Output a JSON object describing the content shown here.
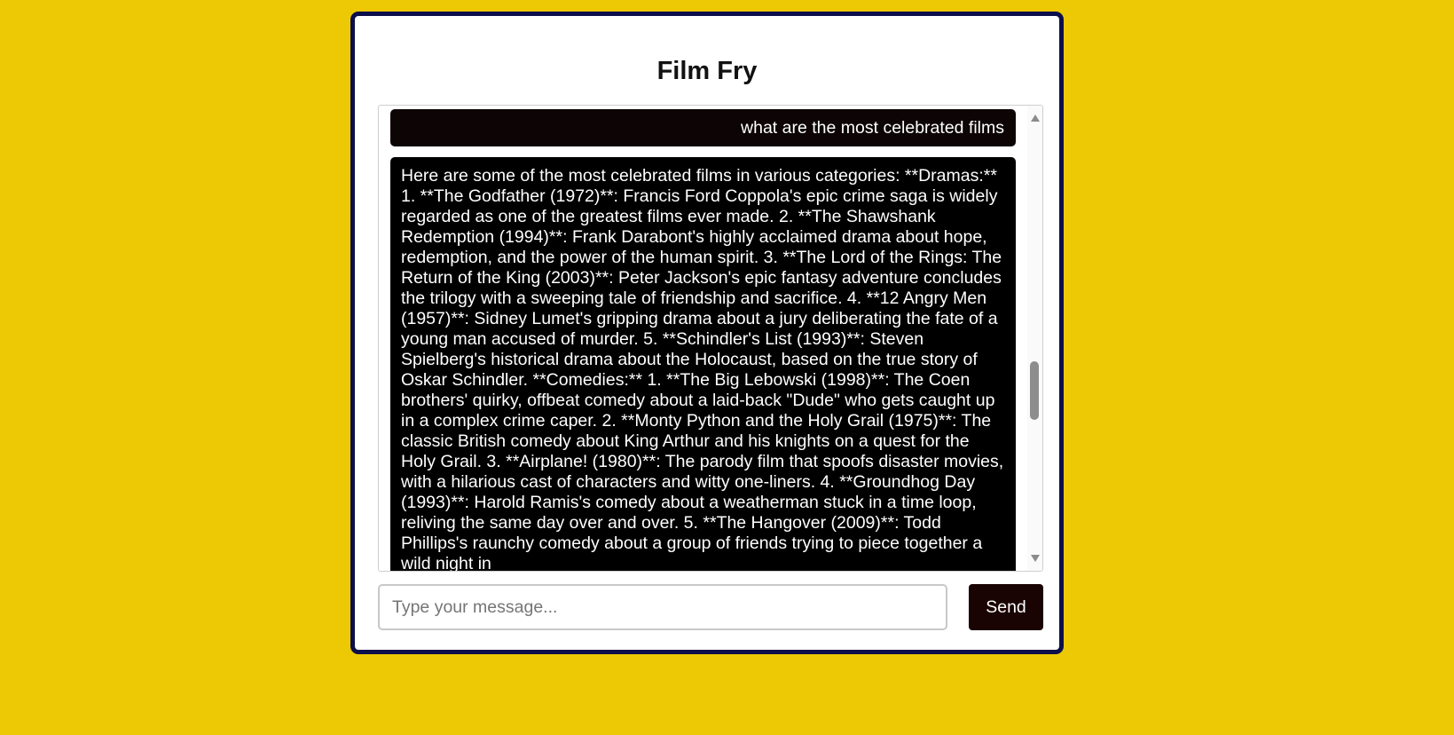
{
  "app": {
    "title": "Film Fry"
  },
  "chat": {
    "messages": [
      {
        "role": "user",
        "text": "what are the most celebrated films"
      },
      {
        "role": "assistant",
        "text": "Here are some of the most celebrated films in various categories: **Dramas:** 1. **The Godfather (1972)**: Francis Ford Coppola's epic crime saga is widely regarded as one of the greatest films ever made. 2. **The Shawshank Redemption (1994)**: Frank Darabont's highly acclaimed drama about hope, redemption, and the power of the human spirit. 3. **The Lord of the Rings: The Return of the King (2003)**: Peter Jackson's epic fantasy adventure concludes the trilogy with a sweeping tale of friendship and sacrifice. 4. **12 Angry Men (1957)**: Sidney Lumet's gripping drama about a jury deliberating the fate of a young man accused of murder. 5. **Schindler's List (1993)**: Steven Spielberg's historical drama about the Holocaust, based on the true story of Oskar Schindler. **Comedies:** 1. **The Big Lebowski (1998)**: The Coen brothers' quirky, offbeat comedy about a laid-back \"Dude\" who gets caught up in a complex crime caper. 2. **Monty Python and the Holy Grail (1975)**: The classic British comedy about King Arthur and his knights on a quest for the Holy Grail. 3. **Airplane! (1980)**: The parody film that spoofs disaster movies, with a hilarious cast of characters and witty one-liners. 4. **Groundhog Day (1993)**: Harold Ramis's comedy about a weatherman stuck in a time loop, reliving the same day over and over. 5. **The Hangover (2009)**: Todd Phillips's raunchy comedy about a group of friends trying to piece together a wild night in"
      }
    ]
  },
  "composer": {
    "placeholder": "Type your message...",
    "value": "",
    "send_label": "Send"
  },
  "colors": {
    "background": "#edc905",
    "card_border": "#0c0f4b",
    "user_bubble": "#0d0505",
    "assistant_bubble": "#000000",
    "send_button": "#1a0303"
  }
}
